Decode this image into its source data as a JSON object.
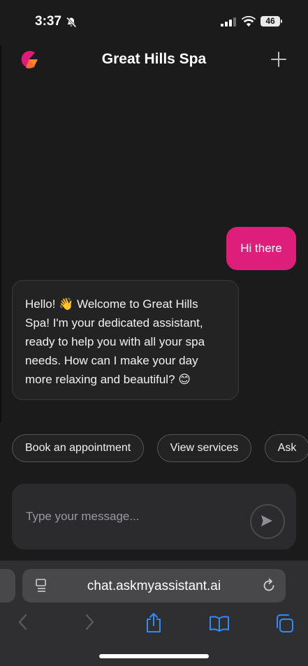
{
  "status_bar": {
    "time": "3:37",
    "battery": "46"
  },
  "header": {
    "title": "Great Hills Spa"
  },
  "messages": {
    "user": "Hi there",
    "bot": "Hello! 👋 Welcome to Great Hills Spa! I'm your dedicated assistant, ready to help you with all your spa needs. How can I make your day more relaxing and beautiful? 😊"
  },
  "chips": [
    "Book an appointment",
    "View services",
    "Ask"
  ],
  "composer": {
    "placeholder": "Type your message..."
  },
  "browser": {
    "url": "chat.askmyassistant.ai"
  },
  "colors": {
    "accent": "#de1f7a",
    "background": "#1b1b1c",
    "browser_blue": "#2f8cff"
  },
  "icons": [
    "bell-slash-icon",
    "cellular-icon",
    "wifi-icon",
    "battery-icon",
    "brand-logo",
    "plus-icon",
    "send-icon",
    "tabs-icon",
    "reload-icon",
    "back-icon",
    "forward-icon",
    "share-icon",
    "bookmarks-icon",
    "tab-overview-icon"
  ]
}
